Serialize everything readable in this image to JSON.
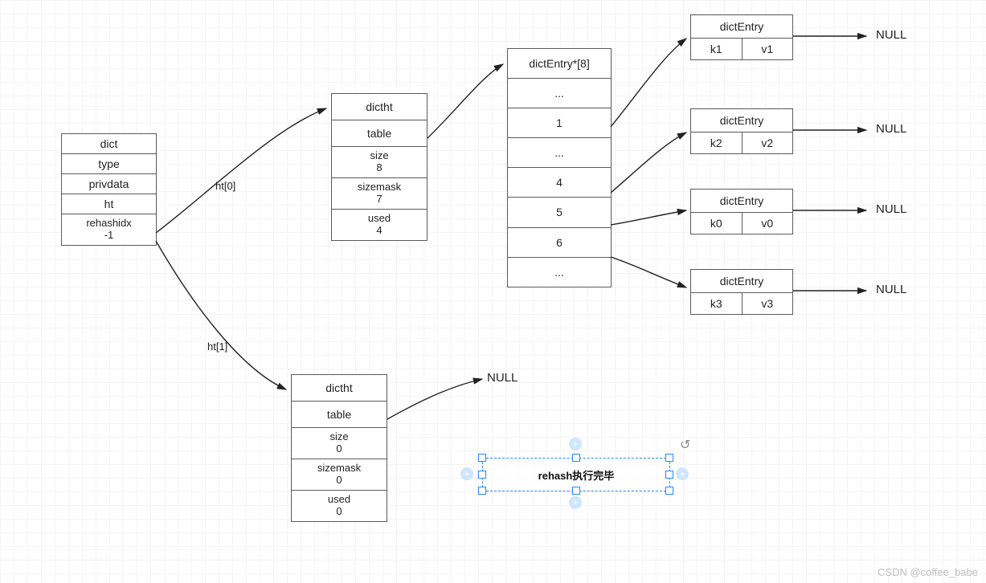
{
  "dict": {
    "title": "dict",
    "fields": [
      "type",
      "privdata",
      "ht"
    ],
    "rehash_label": "rehashidx",
    "rehash_val": "-1"
  },
  "dictht0": {
    "title": "dictht",
    "table": "table",
    "size_label": "size",
    "size": "8",
    "mask_label": "sizemask",
    "mask": "7",
    "used_label": "used",
    "used": "4"
  },
  "dictht1": {
    "title": "dictht",
    "table": "table",
    "size_label": "size",
    "size": "0",
    "mask_label": "sizemask",
    "mask": "0",
    "used_label": "used",
    "used": "0"
  },
  "bucket": {
    "title": "dictEntry*[8]",
    "slots": [
      "...",
      "1",
      "...",
      "4",
      "5",
      "6",
      "..."
    ]
  },
  "entries": [
    {
      "name": "dictEntry",
      "k": "k1",
      "v": "v1"
    },
    {
      "name": "dictEntry",
      "k": "k2",
      "v": "v2"
    },
    {
      "name": "dictEntry",
      "k": "k0",
      "v": "v0"
    },
    {
      "name": "dictEntry",
      "k": "k3",
      "v": "v3"
    }
  ],
  "labels": {
    "ht0": "ht[0]",
    "ht1": "ht[1]"
  },
  "nulls": [
    "NULL",
    "NULL",
    "NULL",
    "NULL",
    "NULL"
  ],
  "annotation": "rehash执行完毕",
  "watermark": "CSDN @coffee_babe"
}
